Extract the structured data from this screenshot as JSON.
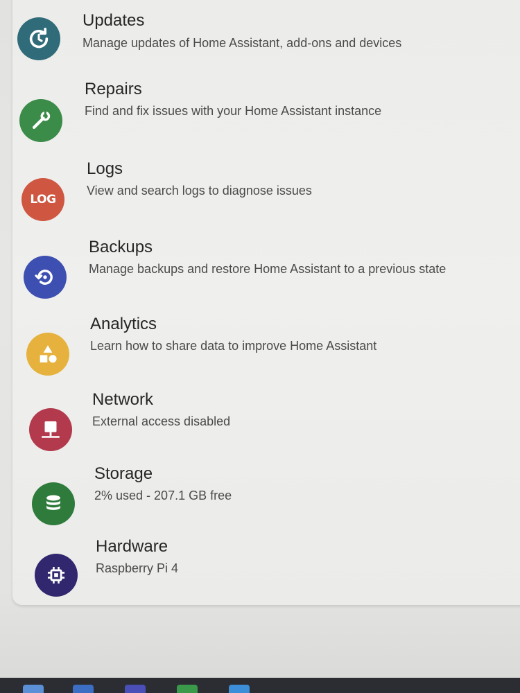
{
  "colors": {
    "updates": "#2f6b78",
    "repairs": "#3b8b49",
    "logs": "#cf5641",
    "backups": "#3d4fb0",
    "analytics": "#e6b23d",
    "network": "#b23a4c",
    "storage": "#2e7b3b",
    "hardware": "#30276e"
  },
  "menu": {
    "items": [
      {
        "title": "Updates",
        "subtitle": "Manage updates of Home Assistant, add-ons and devices",
        "icon": "update-icon"
      },
      {
        "title": "Repairs",
        "subtitle": "Find and fix issues with your Home Assistant instance",
        "icon": "wrench-icon"
      },
      {
        "title": "Logs",
        "subtitle": "View and search logs to diagnose issues",
        "icon": "log-icon",
        "icon_text": "LOG"
      },
      {
        "title": "Backups",
        "subtitle": "Manage backups and restore Home Assistant to a previous state",
        "icon": "backup-restore-icon"
      },
      {
        "title": "Analytics",
        "subtitle": "Learn how to share data to improve Home Assistant",
        "icon": "shapes-icon"
      },
      {
        "title": "Network",
        "subtitle": "External access disabled",
        "icon": "network-icon"
      },
      {
        "title": "Storage",
        "subtitle": "2% used - 207.1 GB free",
        "icon": "database-icon"
      },
      {
        "title": "Hardware",
        "subtitle": "Raspberry Pi 4",
        "icon": "chip-icon"
      }
    ]
  }
}
